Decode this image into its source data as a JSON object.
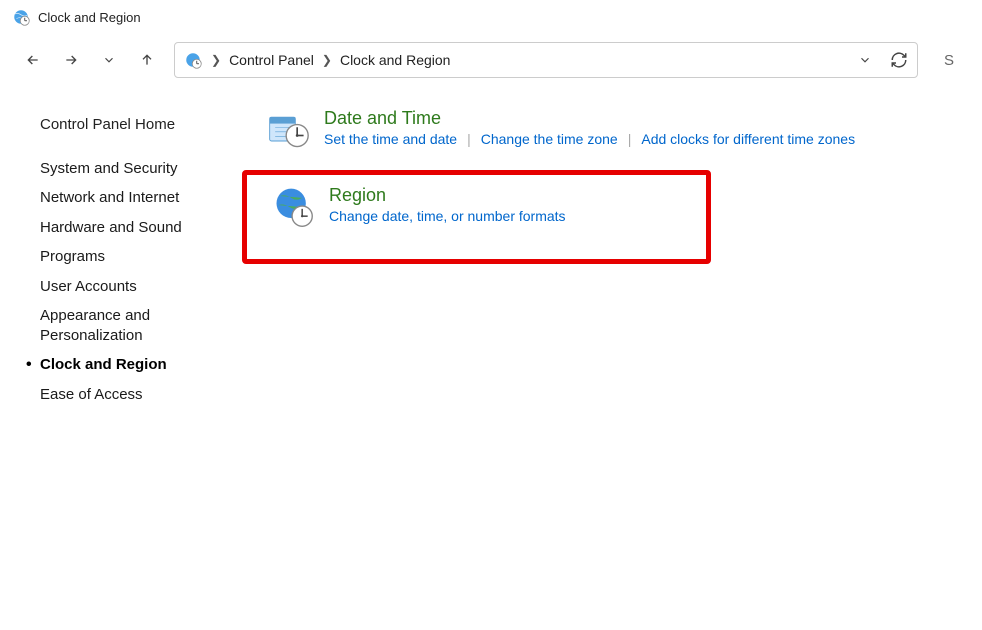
{
  "window": {
    "title": "Clock and Region"
  },
  "breadcrumbs": {
    "seg0": "Control Panel",
    "seg1": "Clock and Region"
  },
  "sidebar": {
    "home": "Control Panel Home",
    "items": [
      "System and Security",
      "Network and Internet",
      "Hardware and Sound",
      "Programs",
      "User Accounts",
      "Appearance and Personalization",
      "Clock and Region",
      "Ease of Access"
    ],
    "active_index": 6
  },
  "categories": {
    "datetime": {
      "title": "Date and Time",
      "links": [
        "Set the time and date",
        "Change the time zone",
        "Add clocks for different time zones"
      ]
    },
    "region": {
      "title": "Region",
      "links": [
        "Change date, time, or number formats"
      ]
    }
  }
}
